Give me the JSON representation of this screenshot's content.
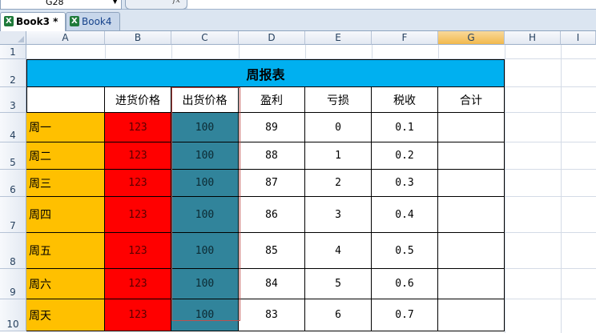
{
  "formula_bar": {
    "name_box": "G28",
    "fx_label": "fx",
    "formula": ""
  },
  "tabs": [
    {
      "label": "Book3 *",
      "active": true
    },
    {
      "label": "Book4",
      "active": false
    }
  ],
  "columns": [
    "A",
    "B",
    "C",
    "D",
    "E",
    "F",
    "G",
    "H",
    "I"
  ],
  "rows": [
    "1",
    "2",
    "3",
    "4",
    "5",
    "6",
    "7",
    "8",
    "9",
    "10"
  ],
  "table": {
    "title": "周报表",
    "headers": [
      "进货价格",
      "出货价格",
      "盈利",
      "亏损",
      "税收",
      "合计"
    ],
    "data": [
      {
        "day": "周一",
        "buy": "123",
        "sell": "100",
        "profit": "89",
        "loss": "0",
        "tax": "0.1",
        "total": ""
      },
      {
        "day": "周二",
        "buy": "123",
        "sell": "100",
        "profit": "88",
        "loss": "1",
        "tax": "0.2",
        "total": ""
      },
      {
        "day": "周三",
        "buy": "123",
        "sell": "100",
        "profit": "87",
        "loss": "2",
        "tax": "0.3",
        "total": ""
      },
      {
        "day": "周四",
        "buy": "123",
        "sell": "100",
        "profit": "86",
        "loss": "3",
        "tax": "0.4",
        "total": ""
      },
      {
        "day": "周五",
        "buy": "123",
        "sell": "100",
        "profit": "85",
        "loss": "4",
        "tax": "0.5",
        "total": ""
      },
      {
        "day": "周六",
        "buy": "123",
        "sell": "100",
        "profit": "84",
        "loss": "5",
        "tax": "0.6",
        "total": ""
      },
      {
        "day": "周天",
        "buy": "123",
        "sell": "100",
        "profit": "83",
        "loss": "6",
        "tax": "0.7",
        "total": ""
      }
    ]
  },
  "colors": {
    "title_fill": "#00b0f0",
    "day_fill": "#ffc000",
    "buy_fill": "#ff0000",
    "sell_fill": "#31849b",
    "selected_column_header": "#f2b94d"
  }
}
